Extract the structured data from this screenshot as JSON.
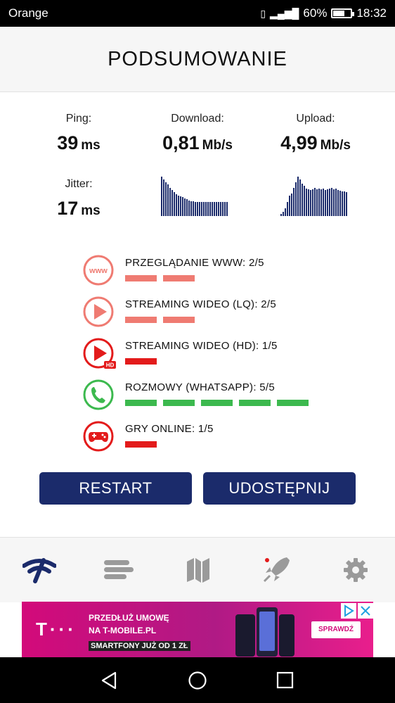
{
  "status_bar": {
    "carrier": "Orange",
    "battery": "60%",
    "time": "18:32"
  },
  "header": {
    "title": "PODSUMOWANIE"
  },
  "stats": {
    "ping": {
      "label": "Ping:",
      "value": "39",
      "unit": "ms"
    },
    "download": {
      "label": "Download:",
      "value": "0,81",
      "unit": "Mb/s"
    },
    "upload": {
      "label": "Upload:",
      "value": "4,99",
      "unit": "Mb/s"
    },
    "jitter": {
      "label": "Jitter:",
      "value": "17",
      "unit": "ms"
    }
  },
  "download_graph": [
    1.0,
    0.92,
    0.86,
    0.8,
    0.72,
    0.66,
    0.6,
    0.56,
    0.52,
    0.5,
    0.48,
    0.44,
    0.42,
    0.4,
    0.38,
    0.37,
    0.36,
    0.36,
    0.36,
    0.36,
    0.36,
    0.36,
    0.36,
    0.36,
    0.36,
    0.36,
    0.36,
    0.36,
    0.36,
    0.36,
    0.36,
    0.35
  ],
  "upload_graph": [
    0.05,
    0.1,
    0.2,
    0.36,
    0.52,
    0.58,
    0.72,
    0.86,
    1.0,
    0.92,
    0.82,
    0.76,
    0.7,
    0.68,
    0.66,
    0.68,
    0.72,
    0.68,
    0.7,
    0.68,
    0.7,
    0.66,
    0.68,
    0.7,
    0.72,
    0.68,
    0.7,
    0.66,
    0.64,
    0.62,
    0.62,
    0.6
  ],
  "quality": [
    {
      "label": "PRZEGLĄDANIE WWW: 2/5",
      "icon": "www-icon",
      "color": "#ef7b72",
      "score": 2,
      "filled": true
    },
    {
      "label": "STREAMING WIDEO (LQ): 2/5",
      "icon": "play-icon",
      "color": "#ef7b72",
      "score": 2
    },
    {
      "label": "STREAMING WIDEO (HD): 1/5",
      "icon": "play-hd-icon",
      "color": "#e31b1b",
      "score": 1
    },
    {
      "label": "ROZMOWY (WHATSAPP): 5/5",
      "icon": "phone-icon",
      "color": "#3cb94e",
      "score": 5
    },
    {
      "label": "GRY ONLINE: 1/5",
      "icon": "gamepad-icon",
      "color": "#e31b1b",
      "score": 1
    }
  ],
  "buttons": {
    "restart": "RESTART",
    "share": "UDOSTĘPNIJ"
  },
  "nav": [
    {
      "icon": "speedtest-icon",
      "color": "#1b2b6b"
    },
    {
      "icon": "history-icon",
      "color": "#9a9a9a"
    },
    {
      "icon": "map-icon",
      "color": "#9a9a9a"
    },
    {
      "icon": "rocket-icon",
      "color": "#9a9a9a"
    },
    {
      "icon": "gear-icon",
      "color": "#9a9a9a"
    }
  ],
  "ad": {
    "line1": "PRZEDŁUŻ UMOWĘ",
    "line2": "NA T-MOBILE.PL",
    "line3": "SMARTFONY JUŻ OD 1 ZŁ",
    "cta": "SPRAWDŹ"
  }
}
